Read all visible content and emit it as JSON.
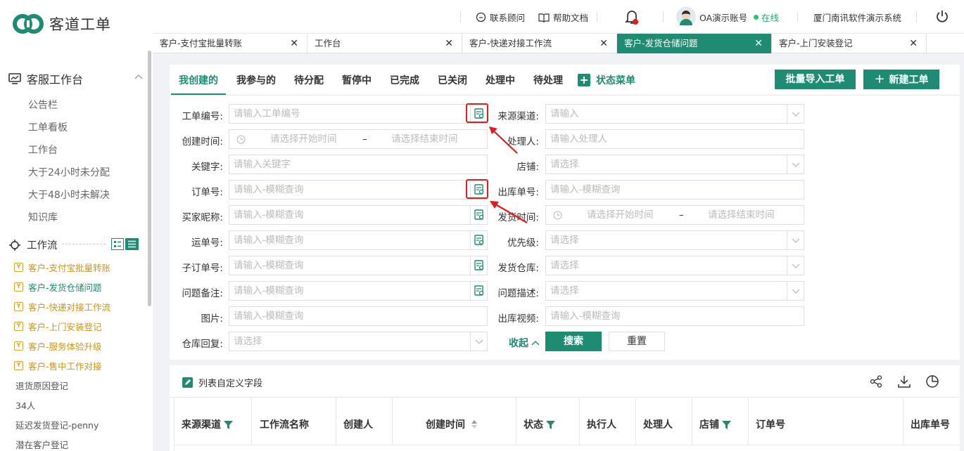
{
  "app": {
    "name": "客道工单"
  },
  "sidebar": {
    "sections": [
      {
        "title": "客服工作台",
        "items": [
          "公告栏",
          "工单看板",
          "工作台",
          "大于24小时未分配",
          "大于48小时未解决",
          "知识库"
        ]
      }
    ],
    "workflow_title": "工作流",
    "workflow_badge": "Y",
    "workflow_items": [
      "客户-支付宝批量转账",
      "客户-发货仓储问题",
      "客户-快递对接工作流",
      "客户-上门安装登记",
      "客户-服务体验升级",
      "客户-售中工作对接"
    ],
    "plain_items": [
      "退货原因登记",
      "34人",
      "延迟发货登记-penny",
      "潜在客户登记"
    ]
  },
  "topbar": {
    "contact": "联系顾问",
    "help": "帮助文档",
    "account": "OA演示账号",
    "status": "在线",
    "company": "厦门南讯软件演示系统"
  },
  "tabs": [
    "客户-支付宝批量转账",
    "工作台",
    "客户-快递对接工作流",
    "客户-发货仓储问题",
    "客户-上门安装登记"
  ],
  "tab_close": "✕",
  "subtabs": [
    "我创建的",
    "我参与的",
    "待分配",
    "暂停中",
    "已完成",
    "已关闭",
    "处理中",
    "待处理",
    "状态菜单"
  ],
  "buttons": {
    "import": "批量导入工单",
    "new": "新建工单",
    "new_plus": "+",
    "search": "搜索",
    "reset": "重置",
    "collapse": "收起"
  },
  "form": {
    "left": [
      {
        "label": "工单编号:",
        "placeholder": "请输入工单编号",
        "kind": "icon"
      },
      {
        "label": "创建时间:",
        "start": "请选择开始时间",
        "end": "请选择结束时间",
        "sep": "–",
        "kind": "date"
      },
      {
        "label": "关键字:",
        "placeholder": "请输入关键字",
        "kind": "text"
      },
      {
        "label": "订单号:",
        "placeholder": "请输入-模糊查询",
        "kind": "icon"
      },
      {
        "label": "买家昵称:",
        "placeholder": "请输入-模糊查询",
        "kind": "icon"
      },
      {
        "label": "运单号:",
        "placeholder": "请输入-模糊查询",
        "kind": "icon"
      },
      {
        "label": "子订单号:",
        "placeholder": "请输入-模糊查询",
        "kind": "icon"
      },
      {
        "label": "问题备注:",
        "placeholder": "请输入-模糊查询",
        "kind": "icon"
      },
      {
        "label": "图片:",
        "placeholder": "请输入-模糊查询",
        "kind": "text"
      },
      {
        "label": "仓库回复:",
        "placeholder": "请选择",
        "kind": "select"
      }
    ],
    "right": [
      {
        "label": "来源渠道:",
        "placeholder": "请输入",
        "kind": "select"
      },
      {
        "label": "处理人:",
        "placeholder": "请输入处理人",
        "kind": "text"
      },
      {
        "label": "店铺:",
        "placeholder": "请选择",
        "kind": "select"
      },
      {
        "label": "出库单号:",
        "placeholder": "请输入-模糊查询",
        "kind": "text"
      },
      {
        "label": "发货时间:",
        "start": "请选择开始时间",
        "end": "请选择结束时间",
        "sep": "–",
        "kind": "date"
      },
      {
        "label": "优先级:",
        "placeholder": "请选择",
        "kind": "select"
      },
      {
        "label": "发货仓库:",
        "placeholder": "请选择",
        "kind": "select"
      },
      {
        "label": "问题描述:",
        "placeholder": "请选择",
        "kind": "select"
      },
      {
        "label": "出库视频:",
        "placeholder": "请输入-模糊查询",
        "kind": "text"
      }
    ]
  },
  "table": {
    "custom_fields": "列表自定义字段",
    "columns": [
      "来源渠道",
      "工作流名称",
      "创建人",
      "创建时间",
      "状态",
      "执行人",
      "处理人",
      "店铺",
      "订单号",
      "出库单号"
    ]
  },
  "colors": {
    "brand": "#1e8c73",
    "warn": "#e01c1c",
    "workflow": "#c9941a"
  }
}
